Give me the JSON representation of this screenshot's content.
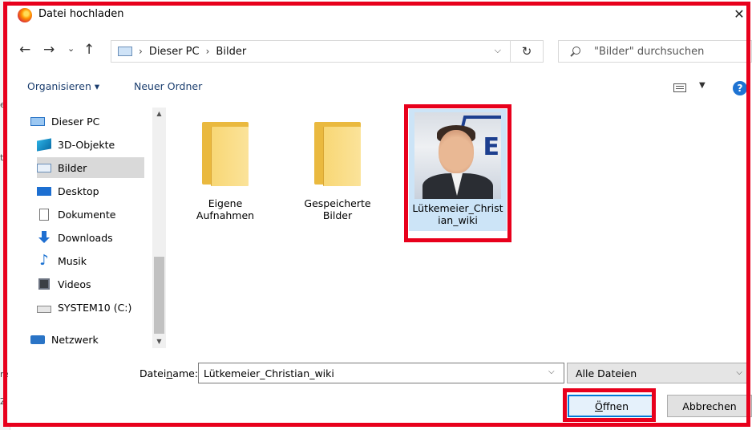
{
  "window": {
    "title": "Datei hochladen",
    "close": "✕"
  },
  "nav": {
    "back": "←",
    "forward": "→",
    "recent": "⌄",
    "up": "↑",
    "breadcrumb": [
      "Dieser PC",
      "Bilder"
    ],
    "breadcrumb_sep": "›",
    "address_dropdown": "⌵",
    "refresh": "↻",
    "search_placeholder": "\"Bilder\" durchsuchen"
  },
  "toolbar": {
    "organize": "Organisieren ▾",
    "new_folder": "Neuer Ordner",
    "view_dropdown": "▼",
    "help": "?"
  },
  "sidebar": {
    "items": [
      {
        "label": "Dieser PC",
        "icon": "computer-icon"
      },
      {
        "label": "3D-Objekte",
        "icon": "3d-objects-icon"
      },
      {
        "label": "Bilder",
        "icon": "pictures-icon",
        "selected": true
      },
      {
        "label": "Desktop",
        "icon": "desktop-icon"
      },
      {
        "label": "Dokumente",
        "icon": "documents-icon"
      },
      {
        "label": "Downloads",
        "icon": "downloads-icon"
      },
      {
        "label": "Musik",
        "icon": "music-icon"
      },
      {
        "label": "Videos",
        "icon": "videos-icon"
      },
      {
        "label": "SYSTEM10 (C:)",
        "icon": "drive-icon"
      },
      {
        "label": "Netzwerk",
        "icon": "network-icon"
      }
    ]
  },
  "files": {
    "items": [
      {
        "name": "Eigene Aufnahmen",
        "type": "folder"
      },
      {
        "name": "Gespeicherte Bilder",
        "type": "folder"
      },
      {
        "name": "Lütkemeier_Christian_wiki",
        "type": "image",
        "selected": true
      }
    ]
  },
  "footer": {
    "filename_label_pre": "Datei",
    "filename_label_u": "n",
    "filename_label_post": "ame:",
    "filename_value": "Lütkemeier_Christian_wiki",
    "filetype": "Alle Dateien",
    "open_u": "Ö",
    "open_rest": "ffnen",
    "cancel": "Abbrechen"
  },
  "colors": {
    "highlight_red": "#e8001c",
    "selection_blue": "#cce4f7",
    "accent": "#0078d7"
  }
}
